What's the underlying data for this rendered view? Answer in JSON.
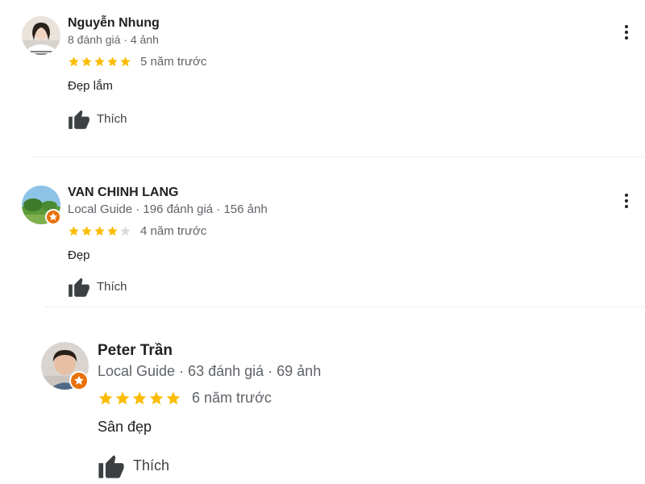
{
  "reviews": [
    {
      "name": "Nguyễn Nhung",
      "meta": "8 đánh giá · 4 ảnh",
      "rating": 5,
      "time": "5 năm trước",
      "text": "Đẹp lắm",
      "like_label": "Thích",
      "local_guide": false
    },
    {
      "name": "VAN CHINH LANG",
      "meta": "Local Guide · 196 đánh giá · 156 ảnh",
      "rating": 4,
      "time": "4 năm trước",
      "text": "Đẹp",
      "like_label": "Thích",
      "local_guide": true
    },
    {
      "name": "Peter Trần",
      "meta": "Local Guide · 63 đánh giá · 69 ảnh",
      "rating": 5,
      "time": "6 năm trước",
      "text": "Sân đẹp",
      "like_label": "Thích",
      "local_guide": true
    }
  ],
  "colors": {
    "star_filled": "#fbbc04",
    "star_empty": "#dadce0",
    "local_guide_badge": "#e8710a"
  }
}
